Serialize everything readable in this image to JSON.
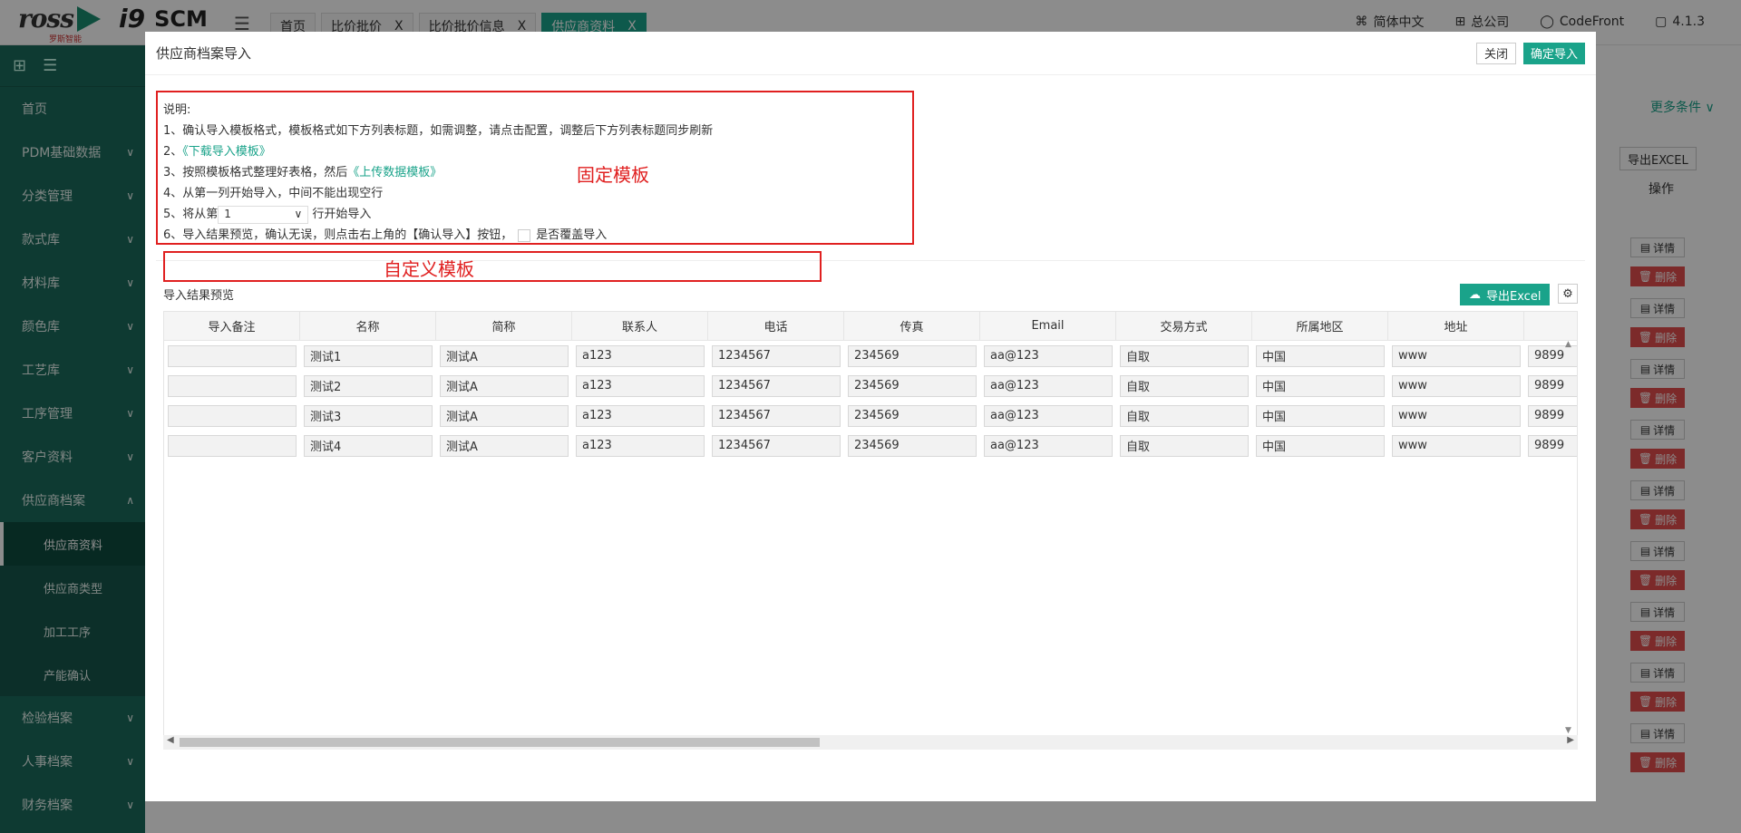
{
  "topbar": {
    "logo_text": "ross",
    "logo_sub": "罗斯智能",
    "brand": "i9",
    "brand2": "SCM",
    "tabs": [
      {
        "label": "首页",
        "closable": false
      },
      {
        "label": "比价批价",
        "closable": true
      },
      {
        "label": "比价批价信息",
        "closable": true
      },
      {
        "label": "供应商资料",
        "closable": true,
        "active": true
      }
    ],
    "close_glyph": "X",
    "lang": "简体中文",
    "company": "总公司",
    "user": "CodeFront",
    "version": "4.1.3"
  },
  "sidebar": {
    "items": [
      {
        "label": "首页",
        "chev": ""
      },
      {
        "label": "PDM基础数据",
        "chev": "∨"
      },
      {
        "label": "分类管理",
        "chev": "∨"
      },
      {
        "label": "款式库",
        "chev": "∨"
      },
      {
        "label": "材料库",
        "chev": "∨"
      },
      {
        "label": "颜色库",
        "chev": "∨"
      },
      {
        "label": "工艺库",
        "chev": "∨"
      },
      {
        "label": "工序管理",
        "chev": "∨"
      },
      {
        "label": "客户资料",
        "chev": "∨"
      },
      {
        "label": "供应商档案",
        "chev": "∧"
      }
    ],
    "sub_items": [
      "供应商资料",
      "供应商类型",
      "加工工序",
      "产能确认"
    ],
    "items_after": [
      {
        "label": "检验档案",
        "chev": "∨"
      },
      {
        "label": "人事档案",
        "chev": "∨"
      },
      {
        "label": "财务档案",
        "chev": "∨"
      }
    ]
  },
  "background": {
    "more_conditions": "更多条件",
    "export_excel": "导出EXCEL",
    "op_header": "操作",
    "detail_label": "详情",
    "delete_label": "删除"
  },
  "modal": {
    "title": "供应商档案导入",
    "close_btn": "关闭",
    "confirm_btn": "确定导入",
    "instructions": {
      "title": "说明:",
      "line1": "1、确认导入模板格式，模板格式如下方列表标题，如需调整，请点击配置，调整后下方列表标题同步刷新",
      "line2_prefix": "2、",
      "line2_link": "《下载导入模板》",
      "line3_prefix": "3、按照模板格式整理好表格，然后",
      "line3_link": "《上传数据模板》",
      "line4": "4、从第一列开始导入，中间不能出现空行",
      "line5_prefix": "5、将从第",
      "line5_value": "1",
      "line5_suffix": "行开始导入",
      "line6_prefix": "6、导入结果预览，确认无误，则点击右上角的【确认导入】按钮，",
      "line6_check": "是否覆盖导入"
    },
    "fixed_template_label": "固定模板",
    "custom_template_label": "自定义模板",
    "preview_label": "导入结果预览",
    "export_excel_btn": "导出Excel",
    "table": {
      "columns": [
        "导入备注",
        "名称",
        "简称",
        "联系人",
        "电话",
        "传真",
        "Email",
        "交易方式",
        "所属地区",
        "地址",
        ""
      ],
      "rows": [
        [
          "",
          "测试1",
          "测试A",
          "a123",
          "1234567",
          "234569",
          "aa@123",
          "自取",
          "中国",
          "www",
          "9899"
        ],
        [
          "",
          "测试2",
          "测试A",
          "a123",
          "1234567",
          "234569",
          "aa@123",
          "自取",
          "中国",
          "www",
          "9899"
        ],
        [
          "",
          "测试3",
          "测试A",
          "a123",
          "1234567",
          "234569",
          "aa@123",
          "自取",
          "中国",
          "www",
          "9899"
        ],
        [
          "",
          "测试4",
          "测试A",
          "a123",
          "1234567",
          "234569",
          "aa@123",
          "自取",
          "中国",
          "www",
          "9899"
        ]
      ]
    }
  }
}
